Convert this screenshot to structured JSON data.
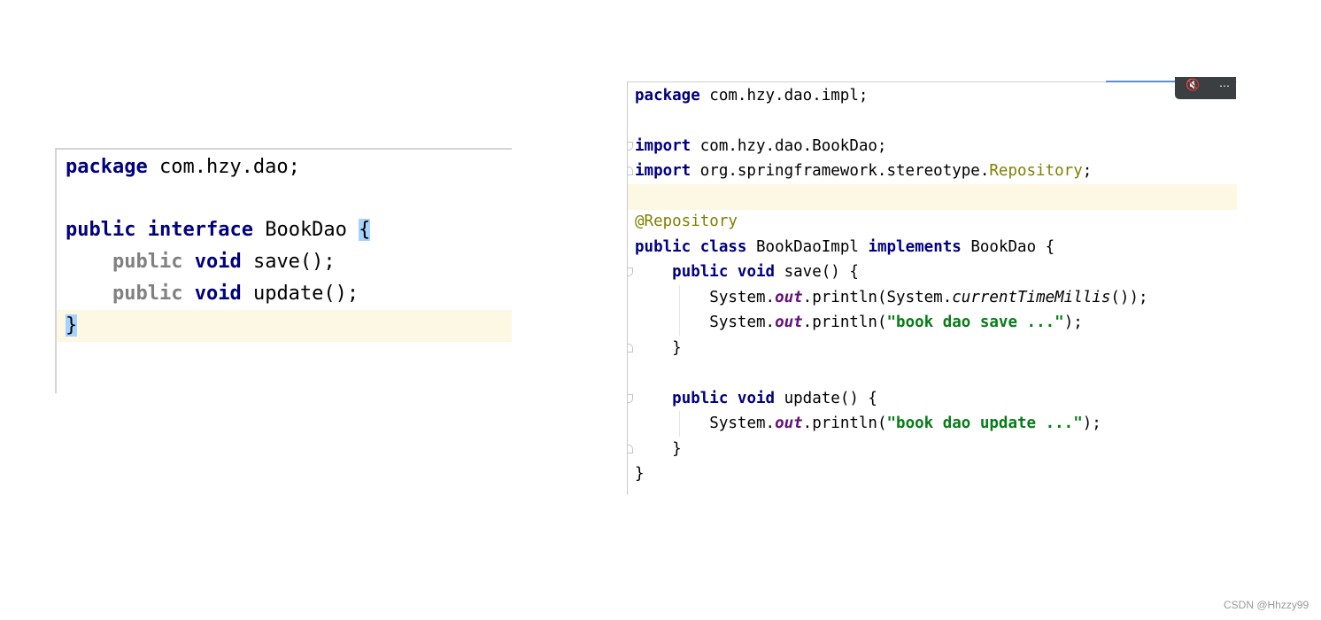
{
  "left_code": {
    "l1": {
      "kw": "package",
      "rest": " com.hzy.dao;"
    },
    "l3": {
      "kw1": "public",
      "kw2": "interface",
      "name": "BookDao",
      "brace": "{"
    },
    "l4": {
      "indent": "    ",
      "kw1": "public",
      "kw2": "void",
      "rest": " save();"
    },
    "l5": {
      "indent": "    ",
      "kw1": "public",
      "kw2": "void",
      "rest": " update();"
    },
    "l6": {
      "brace": "}"
    }
  },
  "right_code": {
    "l1": {
      "kw": "package",
      "rest": " com.hzy.dao.impl;"
    },
    "l3": {
      "kw": "import",
      "rest": " com.hzy.dao.BookDao;"
    },
    "l4": {
      "kw": "import",
      "rest": " org.springframework.stereotype.",
      "cls": "Repository",
      "end": ";"
    },
    "l6": {
      "ann": "@Repository"
    },
    "l7": {
      "kw1": "public",
      "kw2": "class",
      "name": "BookDaoImpl",
      "kw3": "implements",
      "iface": "BookDao",
      "brace": "{"
    },
    "l8": {
      "indent": "    ",
      "kw1": "public",
      "kw2": "void",
      "rest": " save() {"
    },
    "l9": {
      "indent": "        ",
      "sys": "System.",
      "fld": "out",
      "call": ".println(System.",
      "method": "currentTimeMillis",
      "end": "());"
    },
    "l10": {
      "indent": "        ",
      "sys": "System.",
      "fld": "out",
      "call": ".println(",
      "str": "\"book dao save ...\"",
      "end": ");"
    },
    "l11": {
      "indent": "    ",
      "brace": "}"
    },
    "l13": {
      "indent": "    ",
      "kw1": "public",
      "kw2": "void",
      "rest": " update() {"
    },
    "l14": {
      "indent": "        ",
      "sys": "System.",
      "fld": "out",
      "call": ".println(",
      "str": "\"book dao update ...\"",
      "end": ");"
    },
    "l15": {
      "indent": "    ",
      "brace": "}"
    },
    "l16": {
      "brace": "}"
    }
  },
  "toolbar": {
    "text": "…",
    "mic_icon": "mic-off-icon"
  },
  "watermark": "CSDN @Hhzzy99",
  "colors": {
    "keyword": "#000080",
    "keyword_gray": "#808080",
    "annotation": "#808000",
    "string": "#067d17",
    "static_field": "#660e7a",
    "highlight_row": "#fdf8e4",
    "brace_match": "#a6d2ff"
  }
}
